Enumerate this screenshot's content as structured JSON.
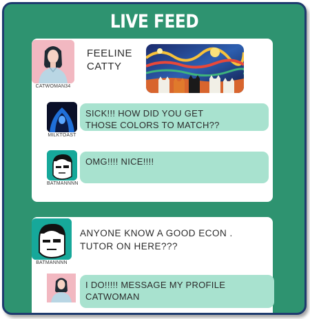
{
  "feed": {
    "title": "LIVE FEED"
  },
  "posts": [
    {
      "author": "CATWOMAN34",
      "text_line1": "FEELINE",
      "text_line2": "CATTY",
      "image": "cats-starry-night-painting",
      "replies": [
        {
          "author": "MILKTOAST",
          "text_line1": "SICK!!! HOW DID YOU GET",
          "text_line2": "THOSE COLORS TO MATCH??"
        },
        {
          "author": "BATMANNNN",
          "text_line1": "OMG!!!! NICE!!!!"
        }
      ]
    },
    {
      "author": "BATMANNNN",
      "text_line1": "ANYONE KNOW A GOOD ECON .",
      "text_line2": "TUTOR ON HERE???",
      "replies": [
        {
          "author": "",
          "text_line1": "I DO!!!!! MESSAGE MY PROFILE",
          "text_line2": "CATWOMAN"
        }
      ]
    }
  ],
  "colors": {
    "background": "#2e9370",
    "border": "#1e3b6e",
    "bubble": "#a8e2cf",
    "avatar_pink": "#f2b8c1",
    "avatar_teal": "#16a89a"
  }
}
